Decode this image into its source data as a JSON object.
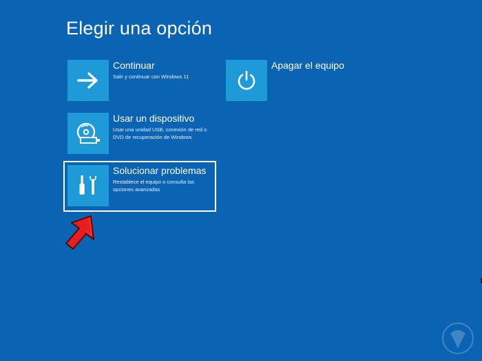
{
  "page": {
    "title": "Elegir una opción",
    "background_color": "#0b63b3",
    "tile_icon_color": "#1f9ad9"
  },
  "options": [
    {
      "title": "Continuar",
      "description": "Salir y continuar con Windows 11",
      "icon": "arrow-right-icon"
    },
    {
      "title": "Usar un dispositivo",
      "description": "Usar una unidad USB, conexión de red o DVD de recuperación de Windows",
      "icon": "disc-usb-icon"
    },
    {
      "title": "Solucionar problemas",
      "description": "Restablece el equipo o consulta las opciones avanzadas",
      "icon": "tools-icon",
      "selected": true
    },
    {
      "title": "Apagar el equipo",
      "description": "",
      "icon": "power-icon"
    }
  ],
  "annotation": {
    "arrow_color": "#e81e1e",
    "icon": "red-pointer-arrow-icon"
  }
}
